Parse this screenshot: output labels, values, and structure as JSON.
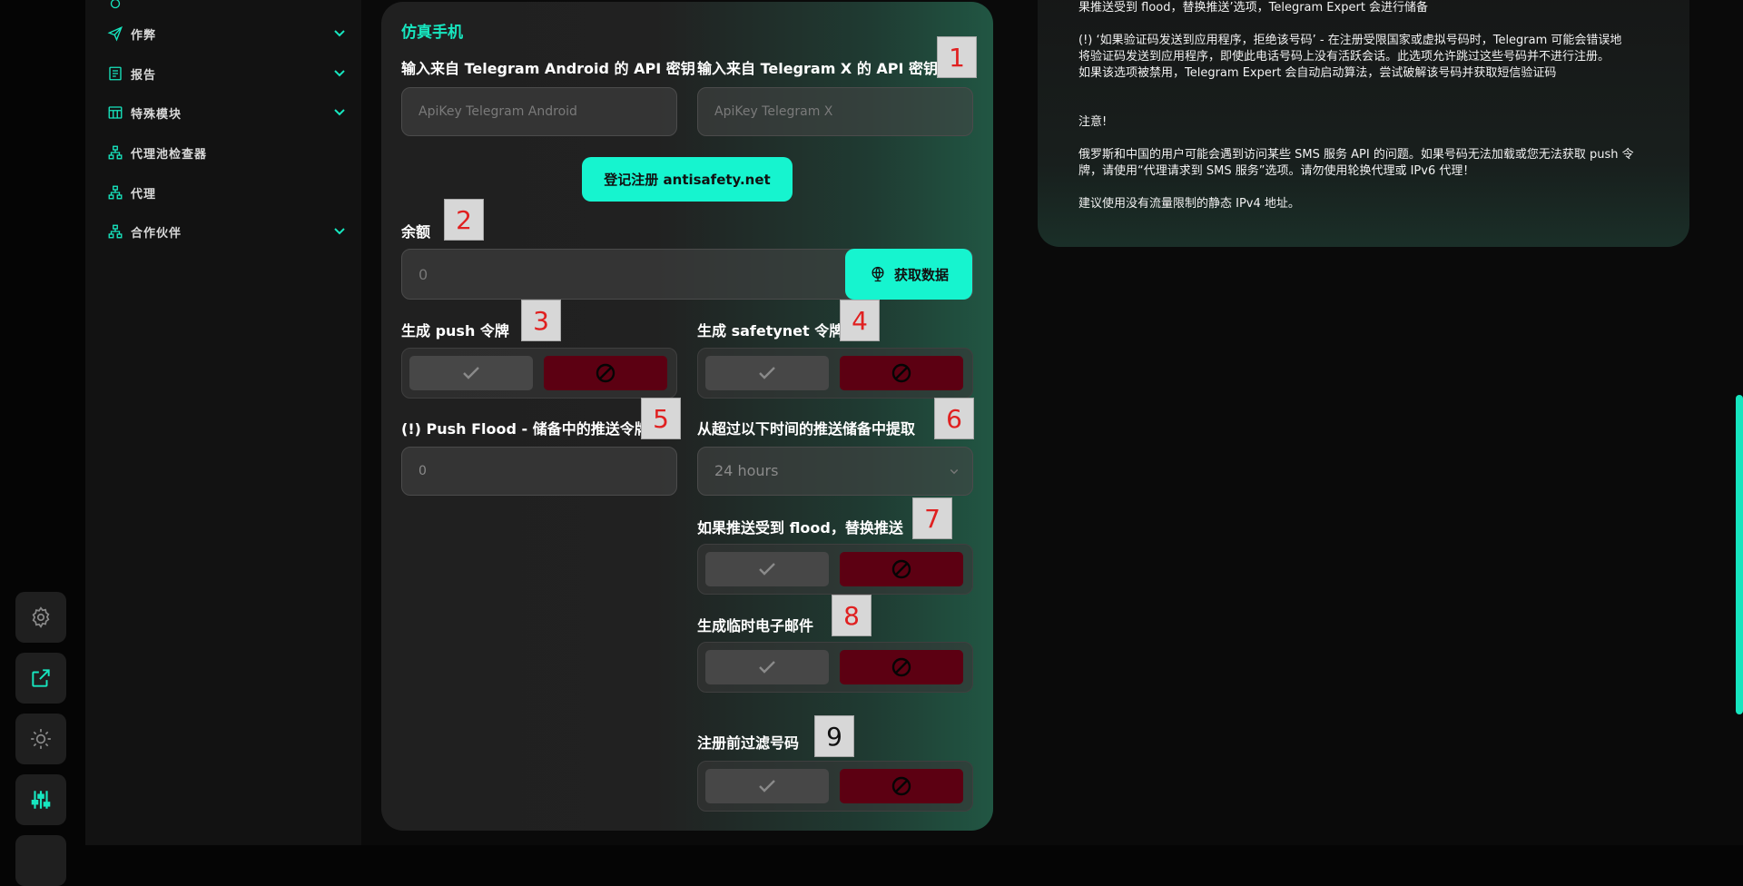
{
  "sidebar": {
    "items": [
      {
        "label": "作弊",
        "icon": "send-icon",
        "expandable": true
      },
      {
        "label": "报告",
        "icon": "report-icon",
        "expandable": true
      },
      {
        "label": "特殊模块",
        "icon": "table-icon",
        "expandable": true
      },
      {
        "label": "代理池检查器",
        "icon": "network-icon",
        "expandable": false
      },
      {
        "label": "代理",
        "icon": "network-icon",
        "expandable": false
      },
      {
        "label": "合作伙伴",
        "icon": "network-icon",
        "expandable": true
      }
    ]
  },
  "rail": {
    "buttons": [
      {
        "icon": "gear-icon"
      },
      {
        "icon": "external-link-icon"
      },
      {
        "icon": "sun-icon"
      },
      {
        "icon": "sliders-icon"
      }
    ]
  },
  "panel": {
    "title": "仿真手机",
    "android_api": {
      "label": "输入来自 Telegram Android 的 API 密钥",
      "placeholder": "ApiKey Telegram Android"
    },
    "x_api": {
      "label": "输入来自 Telegram X 的 API 密钥",
      "placeholder": "ApiKey Telegram X"
    },
    "register_button": "登记注册 antisafety.net",
    "balance": {
      "label": "余额",
      "value": "0"
    },
    "fetch_button": "获取数据",
    "push_token": {
      "label": "生成 push 令牌"
    },
    "safetynet_token": {
      "label": "生成 safetynet 令牌"
    },
    "push_flood": {
      "label": "(!) Push Flood - 储备中的推送令牌",
      "value": "0"
    },
    "fetch_older": {
      "label": "从超过以下时间的推送储备中提取",
      "value": "24 hours"
    },
    "replace_push": {
      "label": "如果推送受到 flood，替换推送"
    },
    "temp_email": {
      "label": "生成临时电子邮件"
    },
    "filter_numbers": {
      "label": "注册前过滤号码"
    }
  },
  "markers": [
    "1",
    "2",
    "3",
    "4",
    "5",
    "6",
    "7",
    "8",
    "9"
  ],
  "info": {
    "lines": [
      "果推送受到 flood，替换推送’选项，Telegram Expert 会进行储备",
      "(!) ‘如果验证码发送到应用程序，拒绝该号码’ - 在注册受限国家或虚拟号码时，Telegram 可能会错误地",
      "将验证码发送到应用程序，即使此电话号码上没有活跃会话。此选项允许跳过这些号码并不进行注册。",
      "如果该选项被禁用，Telegram Expert 会自动启动算法，尝试破解该号码并获取短信验证码",
      "注意!",
      "俄罗斯和中国的用户可能会遇到访问某些 SMS 服务 API 的问题。如果号码无法加载或您无法获取 push 令",
      "牌，请使用“代理请求到 SMS 服务”选项。请勿使用轮换代理或 IPv6 代理！",
      "建议使用没有流量限制的静态 IPv4 地址。"
    ]
  },
  "colors": {
    "accent": "#16f4cf",
    "deny": "#5c0012",
    "background": "#0a0a0a"
  }
}
